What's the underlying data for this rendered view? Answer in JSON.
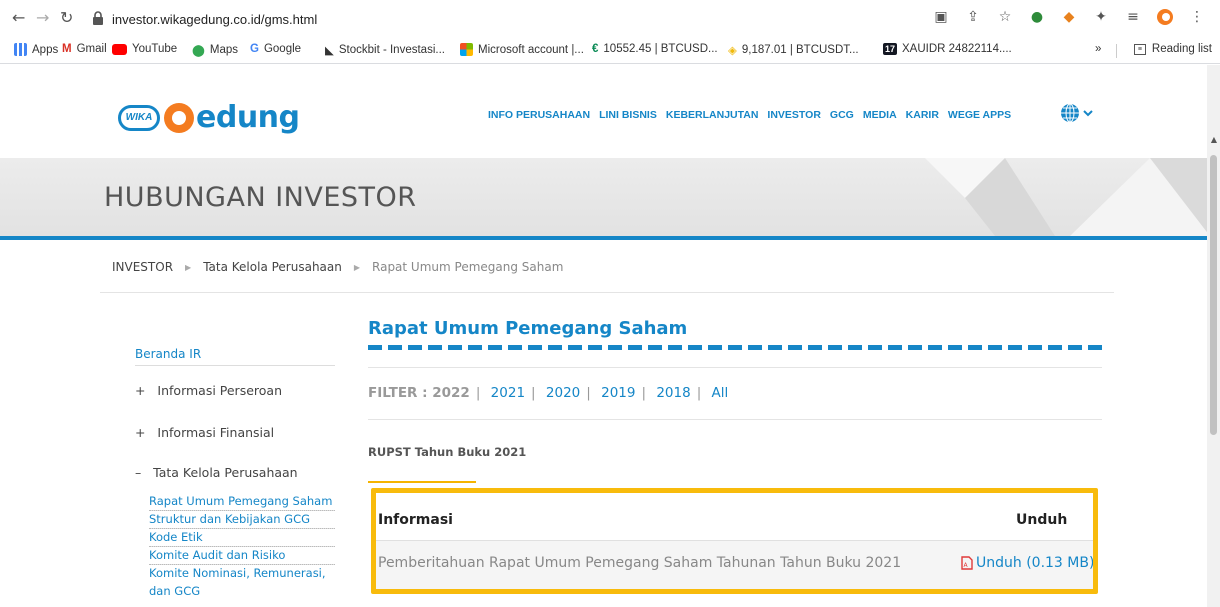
{
  "browser": {
    "url": "investor.wikagedung.co.id/gms.html",
    "bookmarks": [
      {
        "label": "Apps"
      },
      {
        "label": "Gmail"
      },
      {
        "label": "YouTube"
      },
      {
        "label": "Maps"
      },
      {
        "label": "Google"
      },
      {
        "label": "Stockbit - Investasi..."
      },
      {
        "label": "Microsoft account |..."
      },
      {
        "label": "10552.45 | BTCUSD..."
      },
      {
        "label": "9,187.01 | BTCUSDT..."
      },
      {
        "label": "XAUIDR 24822114...."
      }
    ],
    "more_label": "»",
    "reading_list": "Reading list"
  },
  "site": {
    "logo_badge": "WIKA",
    "logo_text": "edung",
    "nav": [
      "INFO PERUSAHAAN",
      "LINI BISNIS",
      "KEBERLANJUTAN",
      "INVESTOR",
      "GCG",
      "MEDIA",
      "KARIR",
      "WEGE APPS"
    ],
    "banner_title": "HUBUNGAN INVESTOR",
    "breadcrumb": [
      "INVESTOR",
      "Tata Kelola Perusahaan",
      "Rapat Umum Pemegang Saham"
    ]
  },
  "sidebar": {
    "home": "Beranda IR",
    "groups": [
      {
        "marker": "+",
        "label": "Informasi Perseroan"
      },
      {
        "marker": "+",
        "label": "Informasi Finansial"
      },
      {
        "marker": "–",
        "label": "Tata Kelola Perusahaan"
      }
    ],
    "sub_items": [
      "Rapat Umum Pemegang Saham",
      "Struktur dan Kebijakan GCG",
      "Kode Etik",
      "Komite Audit dan Risiko",
      "Komite Nominasi, Remunerasi,",
      "dan GCG"
    ]
  },
  "content": {
    "title": "Rapat Umum Pemegang Saham",
    "filter_label": "FILTER : 2022",
    "filter_years": [
      "2021",
      "2020",
      "2019",
      "2018",
      "All"
    ],
    "section": "RUPST Tahun Buku 2021",
    "table": {
      "headers": [
        "Informasi",
        "Unduh"
      ],
      "rows": [
        {
          "info": "Pemberitahuan Rapat Umum Pemegang Saham Tahunan Tahun Buku 2021",
          "download": "Unduh (0.13 MB)"
        }
      ]
    }
  },
  "colors": {
    "brand": "#1586c7",
    "highlight": "#f8bb0c",
    "orange": "#f47c20"
  }
}
